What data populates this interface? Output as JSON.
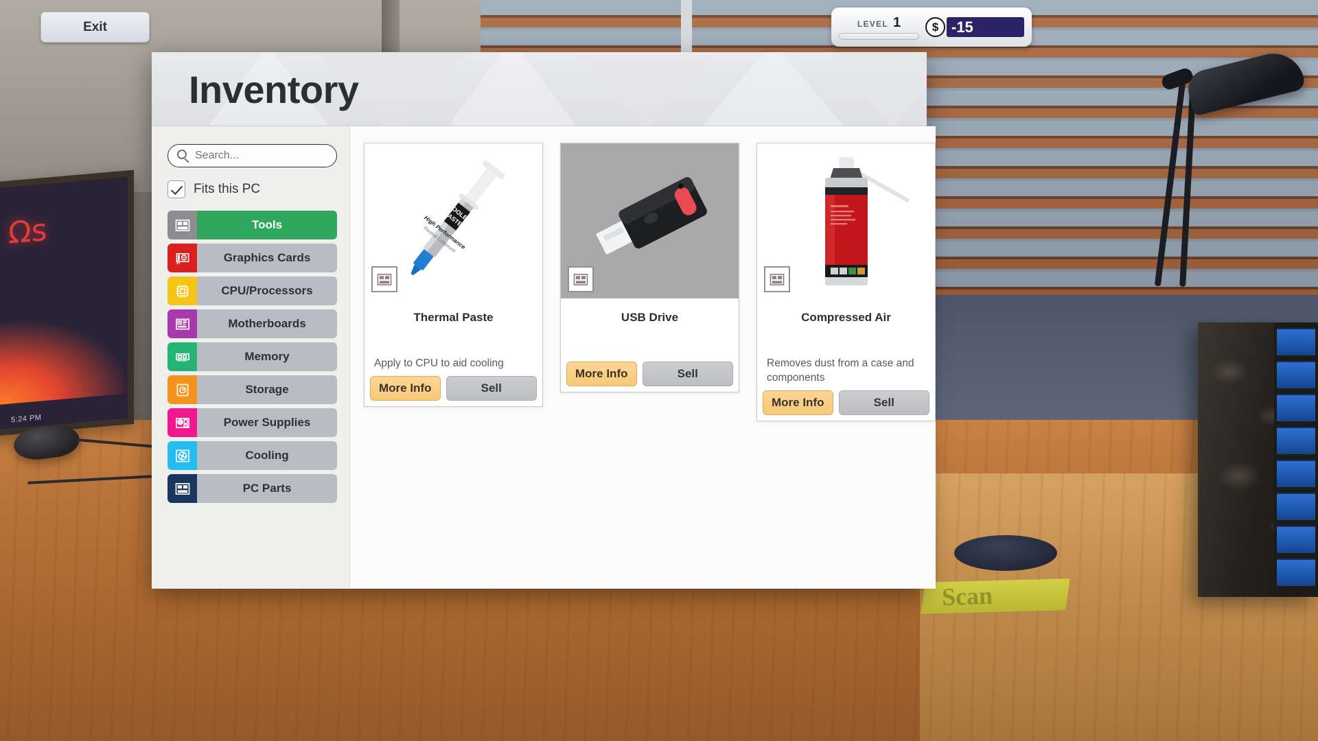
{
  "hud": {
    "exit_label": "Exit",
    "level_label": "LEVEL",
    "level_value": "1",
    "currency_symbol": "$",
    "money_value": "-15",
    "money_color": "#2b2366"
  },
  "panel": {
    "title": "Inventory"
  },
  "sidebar": {
    "search": {
      "placeholder": "Search...",
      "value": "",
      "icon": "search-icon"
    },
    "filter": {
      "label": "Fits this PC",
      "checked": true,
      "icon": "check-icon"
    },
    "categories": [
      {
        "label": "Tools",
        "icon": "pc-case-icon",
        "color": "#8b8d91",
        "active": true
      },
      {
        "label": "Graphics Cards",
        "icon": "gpu-icon",
        "color": "#dc1f1f",
        "active": false
      },
      {
        "label": "CPU/Processors",
        "icon": "cpu-chip-icon",
        "color": "#f5c518",
        "active": false
      },
      {
        "label": "Motherboards",
        "icon": "motherboard-icon",
        "color": "#a838ab",
        "active": false
      },
      {
        "label": "Memory",
        "icon": "ram-stick-icon",
        "color": "#24b473",
        "active": false
      },
      {
        "label": "Storage",
        "icon": "hard-drive-icon",
        "color": "#f4921e",
        "active": false
      },
      {
        "label": "Power Supplies",
        "icon": "psu-icon",
        "color": "#f0188c",
        "active": false
      },
      {
        "label": "Cooling",
        "icon": "fan-icon",
        "color": "#25bdf0",
        "active": false
      },
      {
        "label": "PC Parts",
        "icon": "pc-case-icon",
        "color": "#19365f",
        "active": false
      }
    ],
    "active_color": "#2fa75c"
  },
  "items": [
    {
      "name": "Thermal Paste",
      "description": "Apply to CPU to aid cooling",
      "image": "thermal-paste-syringe",
      "image_bg": "#ffffff",
      "category_icon": "pc-case-icon",
      "more_info_label": "More Info",
      "sell_label": "Sell"
    },
    {
      "name": "USB Drive",
      "description": "",
      "image": "usb-flash-drive",
      "image_bg": "#a9a9a9",
      "category_icon": "pc-case-icon",
      "more_info_label": "More Info",
      "sell_label": "Sell"
    },
    {
      "name": "Compressed Air",
      "description": "Removes dust from a case and components",
      "image": "compressed-air-can",
      "image_bg": "#ffffff",
      "category_icon": "pc-case-icon",
      "more_info_label": "More Info",
      "sell_label": "Sell"
    }
  ],
  "scene": {
    "monitor_logo": "Ωs",
    "monitor_clock": "5:24 PM",
    "desk_pad_text": "Scan"
  }
}
